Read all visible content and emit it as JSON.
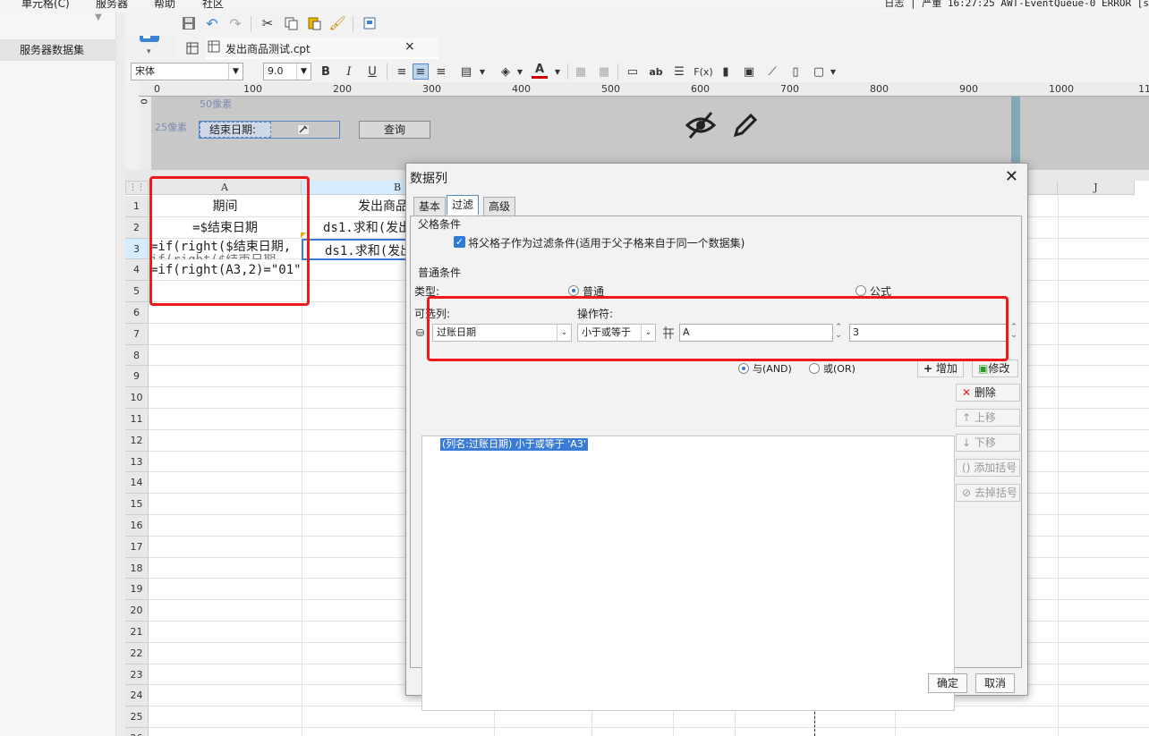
{
  "menubar": {
    "items": [
      "单元格(C)",
      "服务器",
      "帮助",
      "社区"
    ],
    "status": "日志 | 严重 16:27:25 AWT-EventQueue-0 ERROR [s"
  },
  "leftpanel": {
    "item": "服务器数据集"
  },
  "filetab": {
    "name": "发出商品测试.cpt",
    "close": "×"
  },
  "format": {
    "font": "宋体",
    "size": "9.0",
    "bold": "B",
    "italic": "I",
    "underline": "U",
    "fontcolor": "A",
    "ab": "ab",
    "fx": "F(x)"
  },
  "ruler": {
    "marks": [
      "0",
      "100",
      "200",
      "300",
      "400",
      "500",
      "600",
      "700",
      "800",
      "900",
      "1000",
      "11"
    ],
    "vmark": "0"
  },
  "parampane": {
    "label50": "50像素",
    "label25": "25像素",
    "param_label": "结束日期:",
    "query_button": "查询"
  },
  "grid": {
    "columns": [
      "A",
      "B",
      "J"
    ],
    "rows": [
      "1",
      "2",
      "3",
      "4",
      "5",
      "6",
      "7",
      "8",
      "9",
      "10",
      "11",
      "12",
      "13",
      "14",
      "15",
      "16",
      "17",
      "18",
      "19",
      "20",
      "21",
      "22",
      "23",
      "24",
      "25",
      "26"
    ],
    "cells": {
      "a1": "期间",
      "a2": "=$结束日期",
      "a3": "=if(right($结束日期,",
      "a3b": "if(right($结束日期",
      "a4": "=if(right(A3,2)=\"01\",",
      "b1": "发出商品",
      "b2": "ds1.求和(发出",
      "b3": "ds1.求和(发出"
    }
  },
  "dialog": {
    "title": "数据列",
    "close": "✕",
    "tabs": [
      "基本",
      "过滤",
      "高级"
    ],
    "parent_section": "父格条件",
    "parent_checkbox_label": "将父格子作为过滤条件(适用于父子格来自于同一个数据集)",
    "normal_section": "普通条件",
    "type_label": "类型:",
    "type_normal": "普通",
    "type_formula": "公式",
    "column_label": "可选列:",
    "operator_label": "操作符:",
    "column_value": "过账日期",
    "operator_value": "小于或等于",
    "value_field": "A",
    "value_field2": "3",
    "and_label": "与(AND)",
    "or_label": "或(OR)",
    "add_button": "增加",
    "modify_button": "修改",
    "delete_button": "删除",
    "up_button": "上移",
    "down_button": "下移",
    "add_bracket_button": "添加括号",
    "remove_bracket_button": "去掉括号",
    "condition_item": "(列名:过账日期) 小于或等于 'A3'",
    "ok_button": "确定",
    "cancel_button": "取消"
  },
  "colors": {
    "accent": "#2f7ad6",
    "highlight_red": "#f01818",
    "selection": "#3a7bd5"
  }
}
